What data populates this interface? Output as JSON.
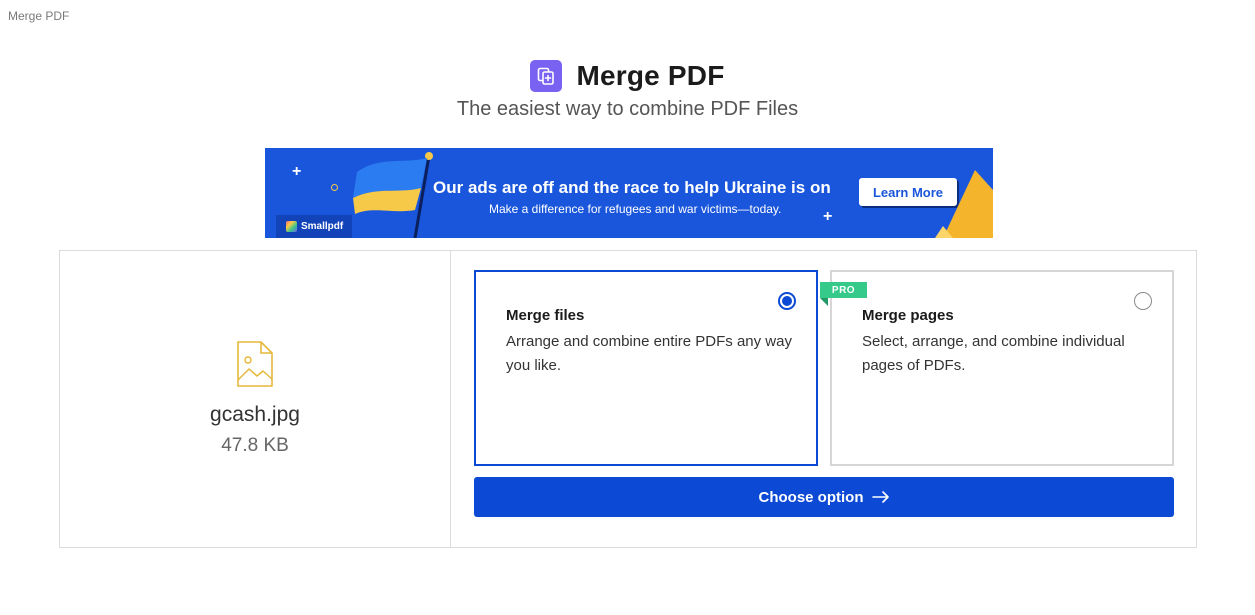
{
  "window": {
    "title": "Merge PDF"
  },
  "header": {
    "title": "Merge PDF",
    "subtitle": "The easiest way to combine PDF Files"
  },
  "banner": {
    "headline": "Our ads are off and the race to help Ukraine is on",
    "subline": "Make a difference for refugees and war victims—today.",
    "button_label": "Learn More",
    "brand_label": "Smallpdf"
  },
  "file": {
    "name": "gcash.jpg",
    "size": "47.8 KB"
  },
  "options": [
    {
      "title": "Merge files",
      "description": "Arrange and combine entire PDFs any way you like.",
      "selected": true
    },
    {
      "title": "Merge pages",
      "description": "Select, arrange, and combine individual pages of PDFs.",
      "selected": false,
      "badge": "PRO"
    }
  ],
  "action": {
    "label": "Choose option"
  },
  "colors": {
    "accent": "#0c49d4",
    "app_icon": "#7961f2",
    "banner": "#1a56db",
    "pro_badge": "#35c98a",
    "file_icon": "#e5b93c"
  },
  "icons": {
    "app": "merge-pdf-icon",
    "file": "image-file-icon",
    "action": "arrow-right-icon"
  }
}
